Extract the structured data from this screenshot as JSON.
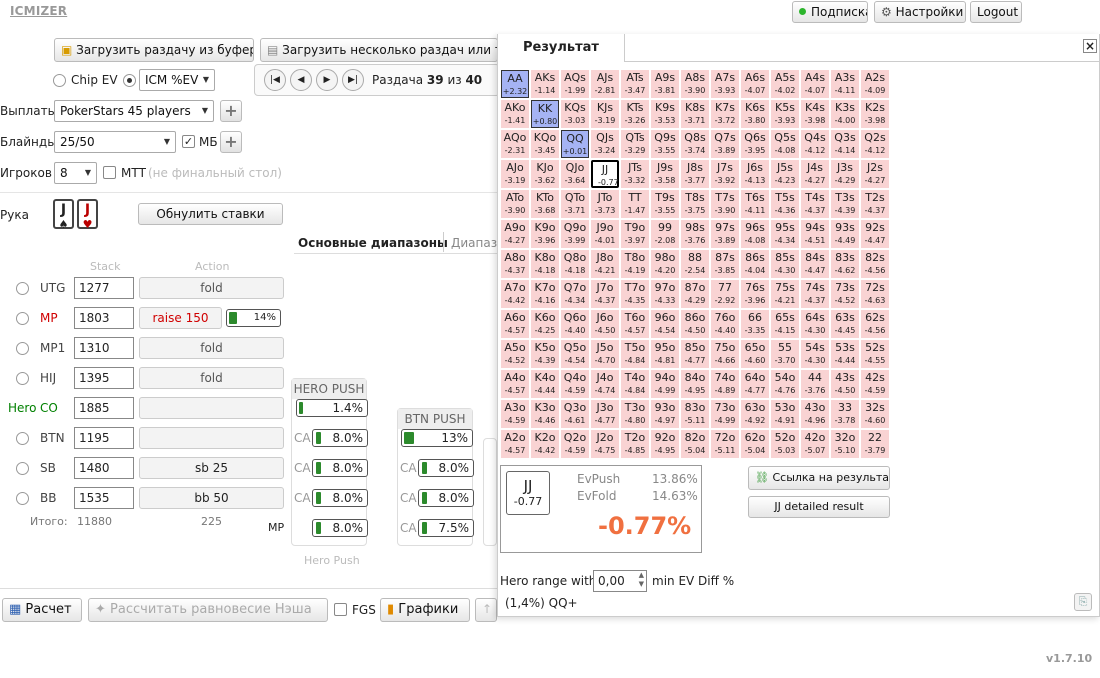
{
  "app": {
    "logo": "ICMIZER",
    "version": "v1.7.10"
  },
  "topbar": {
    "subscription": "Подписка",
    "settings": "Настройки",
    "logout": "Logout"
  },
  "toolbar": {
    "load_hand": "Загрузить раздачу из буфера",
    "load_multi": "Загрузить несколько раздач или тур",
    "chip_ev": "Chip EV",
    "icm_ev": "ICM %EV",
    "hand_label": "Раздача",
    "hand_num": "39",
    "of": "из",
    "hand_total": "40"
  },
  "form": {
    "payouts_label": "Выплаты",
    "payouts_value": "PokerStars 45 players",
    "blinds_label": "Блайнды",
    "blinds_value": "25/50",
    "mb_label": "МБ",
    "players_label": "Игроков",
    "players_value": "8",
    "mtt_label": "МТТ",
    "mtt_note": "(не финальный стол)",
    "hand_label": "Рука",
    "card1": "J",
    "card2": "J",
    "reset_bets": "Обнулить ставки"
  },
  "tabs": {
    "main": "Основные диапазоны",
    "other": "Диапазо"
  },
  "table_headers": {
    "stack": "Stack",
    "action": "Action"
  },
  "players": [
    {
      "pos": "UTG",
      "stack": "1277",
      "action": "fold",
      "color": "#444"
    },
    {
      "pos": "MP",
      "stack": "1803",
      "action": "raise 150",
      "color": "#d00000",
      "pct": "14%"
    },
    {
      "pos": "MP1",
      "stack": "1310",
      "action": "fold",
      "color": "#444"
    },
    {
      "pos": "HIJ",
      "stack": "1395",
      "action": "fold",
      "color": "#444"
    },
    {
      "pos": "CO",
      "stack": "1885",
      "action": "",
      "color": "#008000",
      "hero": "Hero"
    },
    {
      "pos": "BTN",
      "stack": "1195",
      "action": "",
      "color": "#444"
    },
    {
      "pos": "SB",
      "stack": "1480",
      "action": "sb 25",
      "color": "#444"
    },
    {
      "pos": "BB",
      "stack": "1535",
      "action": "bb 50",
      "color": "#444"
    }
  ],
  "totals": {
    "label": "Итого:",
    "stack": "11880",
    "action": "225"
  },
  "push_cols": {
    "hero_title": "HERO PUSH",
    "hero_val": "1.4%",
    "ca": "CA",
    "hero_ca": [
      "8.0%",
      "8.0%",
      "8.0%",
      "8.0%"
    ],
    "hero_foot": "Hero Push",
    "mp": "MP",
    "btn_title": "BTN PUSH",
    "btn_val": "13%",
    "btn_ca": [
      "8.0%",
      "8.0%",
      "7.5%"
    ]
  },
  "bottom": {
    "calc": "Расчет",
    "nash": "Рассчитать равновесие Нэша",
    "fgs": "FGS",
    "charts": "Графики"
  },
  "result": {
    "title": "Результат",
    "close": "×",
    "link": "Ссылка на результат",
    "detailed": "JJ detailed result",
    "hand": "JJ",
    "hand_ev": "-0.77",
    "ev_push_label": "EvPush",
    "ev_push": "13.86%",
    "ev_fold_label": "EvFold",
    "ev_fold": "14.63%",
    "big": "-0.77%",
    "range_label": "Hero range with",
    "range_value": "0,00",
    "range_suffix": "min EV Diff %",
    "range_result": "(1,4%) QQ+"
  },
  "grid": [
    [
      [
        "AA",
        "+2.32",
        "p"
      ],
      [
        "AKs",
        "-1.14"
      ],
      [
        "AQs",
        "-1.99"
      ],
      [
        "AJs",
        "-2.81"
      ],
      [
        "ATs",
        "-3.47"
      ],
      [
        "A9s",
        "-3.81"
      ],
      [
        "A8s",
        "-3.90"
      ],
      [
        "A7s",
        "-3.93"
      ],
      [
        "A6s",
        "-4.07"
      ],
      [
        "A5s",
        "-4.02"
      ],
      [
        "A4s",
        "-4.07"
      ],
      [
        "A3s",
        "-4.11"
      ],
      [
        "A2s",
        "-4.09"
      ]
    ],
    [
      [
        "AKo",
        "-1.41"
      ],
      [
        "KK",
        "+0.80",
        "p"
      ],
      [
        "KQs",
        "-3.03"
      ],
      [
        "KJs",
        "-3.19"
      ],
      [
        "KTs",
        "-3.26"
      ],
      [
        "K9s",
        "-3.53"
      ],
      [
        "K8s",
        "-3.71"
      ],
      [
        "K7s",
        "-3.72"
      ],
      [
        "K6s",
        "-3.80"
      ],
      [
        "K5s",
        "-3.93"
      ],
      [
        "K4s",
        "-3.98"
      ],
      [
        "K3s",
        "-4.00"
      ],
      [
        "K2s",
        "-3.98"
      ]
    ],
    [
      [
        "AQo",
        "-2.31"
      ],
      [
        "KQo",
        "-3.45"
      ],
      [
        "QQ",
        "+0.01",
        "p"
      ],
      [
        "QJs",
        "-3.24"
      ],
      [
        "QTs",
        "-3.29"
      ],
      [
        "Q9s",
        "-3.55"
      ],
      [
        "Q8s",
        "-3.74"
      ],
      [
        "Q7s",
        "-3.89"
      ],
      [
        "Q6s",
        "-3.95"
      ],
      [
        "Q5s",
        "-4.08"
      ],
      [
        "Q4s",
        "-4.12"
      ],
      [
        "Q3s",
        "-4.14"
      ],
      [
        "Q2s",
        "-4.12"
      ]
    ],
    [
      [
        "AJo",
        "-3.19"
      ],
      [
        "KJo",
        "-3.62"
      ],
      [
        "QJo",
        "-3.64"
      ],
      [
        "JJ",
        "-0.77",
        "s"
      ],
      [
        "JTs",
        "-3.32"
      ],
      [
        "J9s",
        "-3.58"
      ],
      [
        "J8s",
        "-3.77"
      ],
      [
        "J7s",
        "-3.92"
      ],
      [
        "J6s",
        "-4.13"
      ],
      [
        "J5s",
        "-4.23"
      ],
      [
        "J4s",
        "-4.27"
      ],
      [
        "J3s",
        "-4.29"
      ],
      [
        "J2s",
        "-4.27"
      ]
    ],
    [
      [
        "ATo",
        "-3.90"
      ],
      [
        "KTo",
        "-3.68"
      ],
      [
        "QTo",
        "-3.71"
      ],
      [
        "JTo",
        "-3.73"
      ],
      [
        "TT",
        "-1.47"
      ],
      [
        "T9s",
        "-3.55"
      ],
      [
        "T8s",
        "-3.75"
      ],
      [
        "T7s",
        "-3.90"
      ],
      [
        "T6s",
        "-4.11"
      ],
      [
        "T5s",
        "-4.36"
      ],
      [
        "T4s",
        "-4.37"
      ],
      [
        "T3s",
        "-4.39"
      ],
      [
        "T2s",
        "-4.37"
      ]
    ],
    [
      [
        "A9o",
        "-4.27"
      ],
      [
        "K9o",
        "-3.96"
      ],
      [
        "Q9o",
        "-3.99"
      ],
      [
        "J9o",
        "-4.01"
      ],
      [
        "T9o",
        "-3.97"
      ],
      [
        "99",
        "-2.08"
      ],
      [
        "98s",
        "-3.76"
      ],
      [
        "97s",
        "-3.89"
      ],
      [
        "96s",
        "-4.08"
      ],
      [
        "95s",
        "-4.34"
      ],
      [
        "94s",
        "-4.51"
      ],
      [
        "93s",
        "-4.49"
      ],
      [
        "92s",
        "-4.47"
      ]
    ],
    [
      [
        "A8o",
        "-4.37"
      ],
      [
        "K8o",
        "-4.18"
      ],
      [
        "Q8o",
        "-4.18"
      ],
      [
        "J8o",
        "-4.21"
      ],
      [
        "T8o",
        "-4.19"
      ],
      [
        "98o",
        "-4.20"
      ],
      [
        "88",
        "-2.54"
      ],
      [
        "87s",
        "-3.85"
      ],
      [
        "86s",
        "-4.04"
      ],
      [
        "85s",
        "-4.30"
      ],
      [
        "84s",
        "-4.47"
      ],
      [
        "83s",
        "-4.62"
      ],
      [
        "82s",
        "-4.56"
      ]
    ],
    [
      [
        "A7o",
        "-4.42"
      ],
      [
        "K7o",
        "-4.16"
      ],
      [
        "Q7o",
        "-4.34"
      ],
      [
        "J7o",
        "-4.37"
      ],
      [
        "T7o",
        "-4.35"
      ],
      [
        "97o",
        "-4.33"
      ],
      [
        "87o",
        "-4.29"
      ],
      [
        "77",
        "-2.92"
      ],
      [
        "76s",
        "-3.96"
      ],
      [
        "75s",
        "-4.21"
      ],
      [
        "74s",
        "-4.37"
      ],
      [
        "73s",
        "-4.52"
      ],
      [
        "72s",
        "-4.63"
      ]
    ],
    [
      [
        "A6o",
        "-4.57"
      ],
      [
        "K6o",
        "-4.25"
      ],
      [
        "Q6o",
        "-4.40"
      ],
      [
        "J6o",
        "-4.50"
      ],
      [
        "T6o",
        "-4.57"
      ],
      [
        "96o",
        "-4.54"
      ],
      [
        "86o",
        "-4.50"
      ],
      [
        "76o",
        "-4.40"
      ],
      [
        "66",
        "-3.35"
      ],
      [
        "65s",
        "-4.15"
      ],
      [
        "64s",
        "-4.30"
      ],
      [
        "63s",
        "-4.45"
      ],
      [
        "62s",
        "-4.56"
      ]
    ],
    [
      [
        "A5o",
        "-4.52"
      ],
      [
        "K5o",
        "-4.39"
      ],
      [
        "Q5o",
        "-4.54"
      ],
      [
        "J5o",
        "-4.70"
      ],
      [
        "T5o",
        "-4.84"
      ],
      [
        "95o",
        "-4.81"
      ],
      [
        "85o",
        "-4.77"
      ],
      [
        "75o",
        "-4.66"
      ],
      [
        "65o",
        "-4.60"
      ],
      [
        "55",
        "-3.70"
      ],
      [
        "54s",
        "-4.30"
      ],
      [
        "53s",
        "-4.44"
      ],
      [
        "52s",
        "-4.55"
      ]
    ],
    [
      [
        "A4o",
        "-4.57"
      ],
      [
        "K4o",
        "-4.44"
      ],
      [
        "Q4o",
        "-4.59"
      ],
      [
        "J4o",
        "-4.74"
      ],
      [
        "T4o",
        "-4.84"
      ],
      [
        "94o",
        "-4.99"
      ],
      [
        "84o",
        "-4.95"
      ],
      [
        "74o",
        "-4.89"
      ],
      [
        "64o",
        "-4.77"
      ],
      [
        "54o",
        "-4.76"
      ],
      [
        "44",
        "-3.76"
      ],
      [
        "43s",
        "-4.50"
      ],
      [
        "42s",
        "-4.59"
      ]
    ],
    [
      [
        "A3o",
        "-4.59"
      ],
      [
        "K3o",
        "-4.46"
      ],
      [
        "Q3o",
        "-4.61"
      ],
      [
        "J3o",
        "-4.77"
      ],
      [
        "T3o",
        "-4.80"
      ],
      [
        "93o",
        "-4.97"
      ],
      [
        "83o",
        "-5.11"
      ],
      [
        "73o",
        "-4.99"
      ],
      [
        "63o",
        "-4.92"
      ],
      [
        "53o",
        "-4.91"
      ],
      [
        "43o",
        "-4.96"
      ],
      [
        "33",
        "-3.78"
      ],
      [
        "32s",
        "-4.60"
      ]
    ],
    [
      [
        "A2o",
        "-4.57"
      ],
      [
        "K2o",
        "-4.42"
      ],
      [
        "Q2o",
        "-4.59"
      ],
      [
        "J2o",
        "-4.75"
      ],
      [
        "T2o",
        "-4.85"
      ],
      [
        "92o",
        "-4.95"
      ],
      [
        "82o",
        "-5.04"
      ],
      [
        "72o",
        "-5.11"
      ],
      [
        "62o",
        "-5.04"
      ],
      [
        "52o",
        "-5.03"
      ],
      [
        "42o",
        "-5.07"
      ],
      [
        "32o",
        "-5.10"
      ],
      [
        "22",
        "-3.79"
      ]
    ]
  ]
}
